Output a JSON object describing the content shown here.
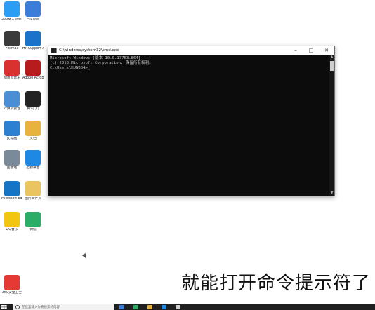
{
  "desktop": {
    "icons": [
      {
        "label": "360安全浏览器",
        "color": "#2a9df4",
        "icon": "browser-icon"
      },
      {
        "label": "百度网盘",
        "color": "#3b7dd8",
        "icon": "cloud-icon"
      },
      {
        "label": "Foxmail",
        "color": "#3a3a3a",
        "icon": "mail-icon"
      },
      {
        "label": "HP Support Assistant",
        "color": "#1a73c8",
        "icon": "help-icon"
      },
      {
        "label": "网易云音乐",
        "color": "#d93030",
        "icon": "music-icon"
      },
      {
        "label": "Adobe Acrobat DC",
        "color": "#b71c1c",
        "icon": "pdf-icon"
      },
      {
        "label": "计算机管理",
        "color": "#4a8fd6",
        "icon": "computer-manage-icon"
      },
      {
        "label": "腾讯QQ",
        "color": "#222222",
        "icon": "qq-icon"
      },
      {
        "label": "此电脑",
        "color": "#2d7fd1",
        "icon": "this-pc-icon"
      },
      {
        "label": "文档",
        "color": "#e7b33c",
        "icon": "folder-icon"
      },
      {
        "label": "回收站",
        "color": "#7a8a99",
        "icon": "recycle-bin-icon"
      },
      {
        "label": "迅捷录音",
        "color": "#1e88e5",
        "icon": "recorder-icon"
      },
      {
        "label": "Microsoft Edge",
        "color": "#1574c4",
        "icon": "edge-icon"
      },
      {
        "label": "图片文件夹",
        "color": "#e9c460",
        "icon": "image-folder-icon"
      },
      {
        "label": "QQ音乐",
        "color": "#f2c511",
        "icon": "qq-music-icon"
      },
      {
        "label": "微信",
        "color": "#2aae67",
        "icon": "wechat-icon"
      },
      {
        "label": "360安全卫士",
        "color": "#e53935",
        "icon": "security-icon"
      }
    ]
  },
  "cmd": {
    "title": "C:\\windows\\system32\\cmd.exe",
    "controls": {
      "minimize": "–",
      "maximize": "□",
      "close": "✕"
    },
    "lines": [
      "Microsoft Windows [版本 10.0.17763.864]",
      "(c) 2018 Microsoft Corporation. 保留所有权利。",
      "",
      "C:\\Users\\HUW004>_"
    ]
  },
  "subtitle": "就能打开命令提示符了",
  "taskbar": {
    "search_placeholder": "在这里输入你要搜索的内容",
    "apps": [
      "#3c7dd9",
      "#2aae67",
      "#e7b33c",
      "#1e88e5",
      "#cfcfcf"
    ]
  }
}
